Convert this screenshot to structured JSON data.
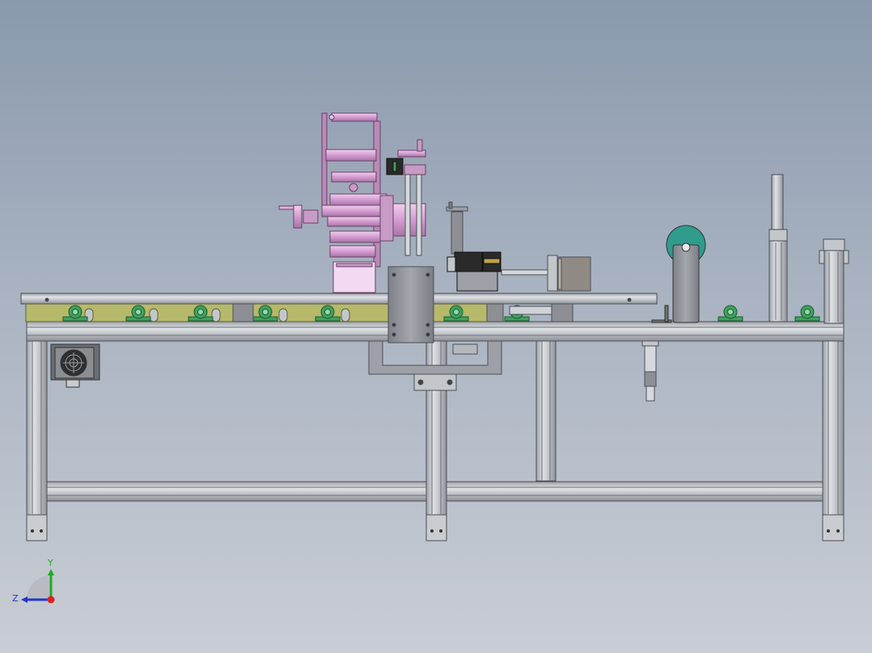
{
  "viewport": {
    "background_top": "#8a99ad",
    "background_bottom": "#c9cdd5"
  },
  "colors": {
    "frame": "#c3c7cc",
    "frame_edge": "#4b4f55",
    "conveyor_plate": "#b7b96a",
    "bearing": "#3fa15e",
    "labeler": "#d7a6d4",
    "motor": "#2a2a2a",
    "roll_teal": "#2f9c8c",
    "block": "#8d8f94"
  },
  "triad": {
    "y_label": "Y",
    "z_label": "Z",
    "y_color": "#22aa22",
    "z_color": "#2233cc",
    "x_color": "#dd2222"
  },
  "parts": [
    "labeling-head",
    "conveyor-rail",
    "aluminum-frame",
    "pillow-block-bearings",
    "fan-motor",
    "label-roll",
    "cylinder-post",
    "side-bracket"
  ]
}
